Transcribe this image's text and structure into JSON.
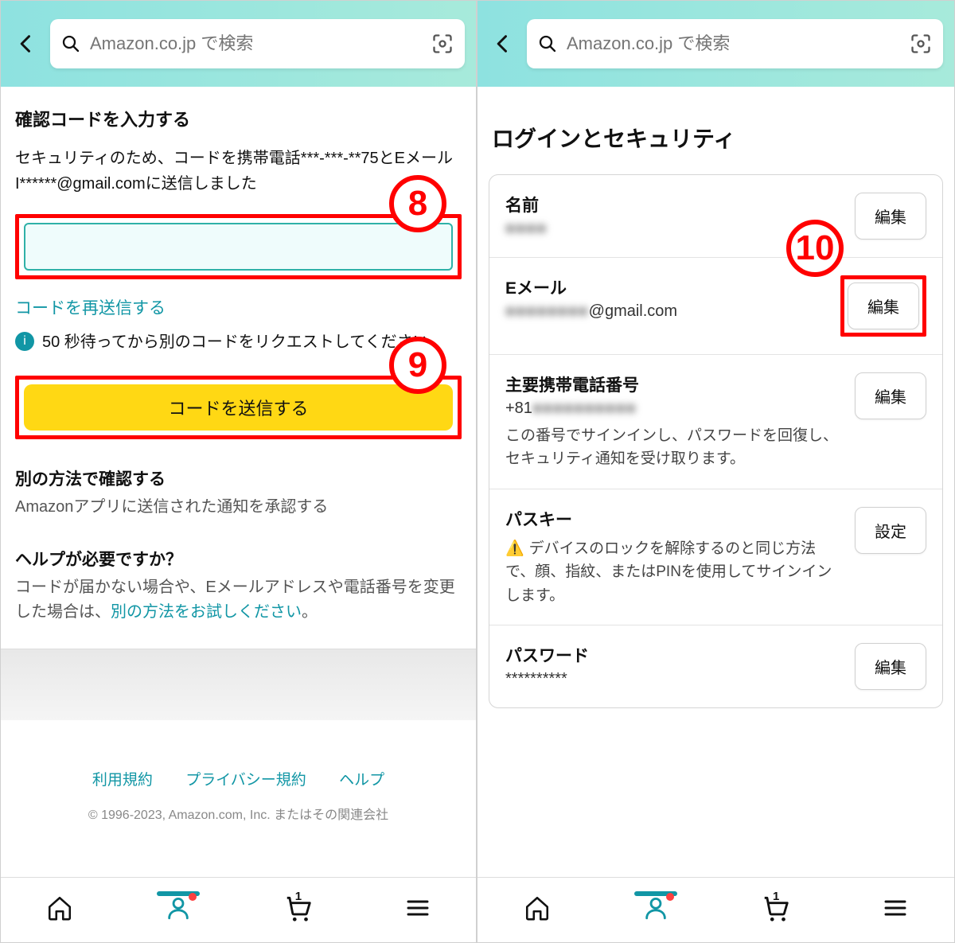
{
  "search": {
    "placeholder": "Amazon.co.jp で検索"
  },
  "left": {
    "title": "確認コードを入力する",
    "subtitle": "セキュリティのため、コードを携帯電話***-***-**75とEメールI******@gmail.comに送信しました",
    "resend_link": "コードを再送信する",
    "info_text": "50 秒待ってから別のコードをリクエストしてください。",
    "send_button": "コードを送信する",
    "alt_heading": "別の方法で確認する",
    "alt_text": "Amazonアプリに送信された通知を承認する",
    "help_heading": "ヘルプが必要ですか？",
    "help_text_pre": "コードが届かない場合や、Eメールアドレスや電話番号を変更した場合は、",
    "help_link": "別の方法をお試しください",
    "help_text_post": "。",
    "footer_links": {
      "terms": "利用規約",
      "privacy": "プライバシー規約",
      "help": "ヘルプ"
    },
    "copyright": "© 1996-2023, Amazon.com, Inc. またはその関連会社"
  },
  "right": {
    "page_title": "ログインとセキュリティ",
    "name": {
      "label": "名前",
      "value": "●●●●",
      "button": "編集"
    },
    "email": {
      "label": "Eメール",
      "value_masked": "●●●●●●●●",
      "value_domain": "@gmail.com",
      "button": "編集"
    },
    "phone": {
      "label": "主要携帯電話番号",
      "value_prefix": "+81",
      "value_masked": "●●●●●●●●●●",
      "note": "この番号でサインインし、パスワードを回復し、セキュリティ通知を受け取ります。",
      "button": "編集"
    },
    "passkey": {
      "label": "パスキー",
      "note": "デバイスのロックを解除するのと同じ方法で、顔、指紋、またはPINを使用してサインインします。",
      "button": "設定"
    },
    "password": {
      "label": "パスワード",
      "value": "**********",
      "button": "編集"
    }
  },
  "nav": {
    "cart_count": "1"
  },
  "annotations": {
    "a8": "8",
    "a9": "9",
    "a10": "10"
  }
}
